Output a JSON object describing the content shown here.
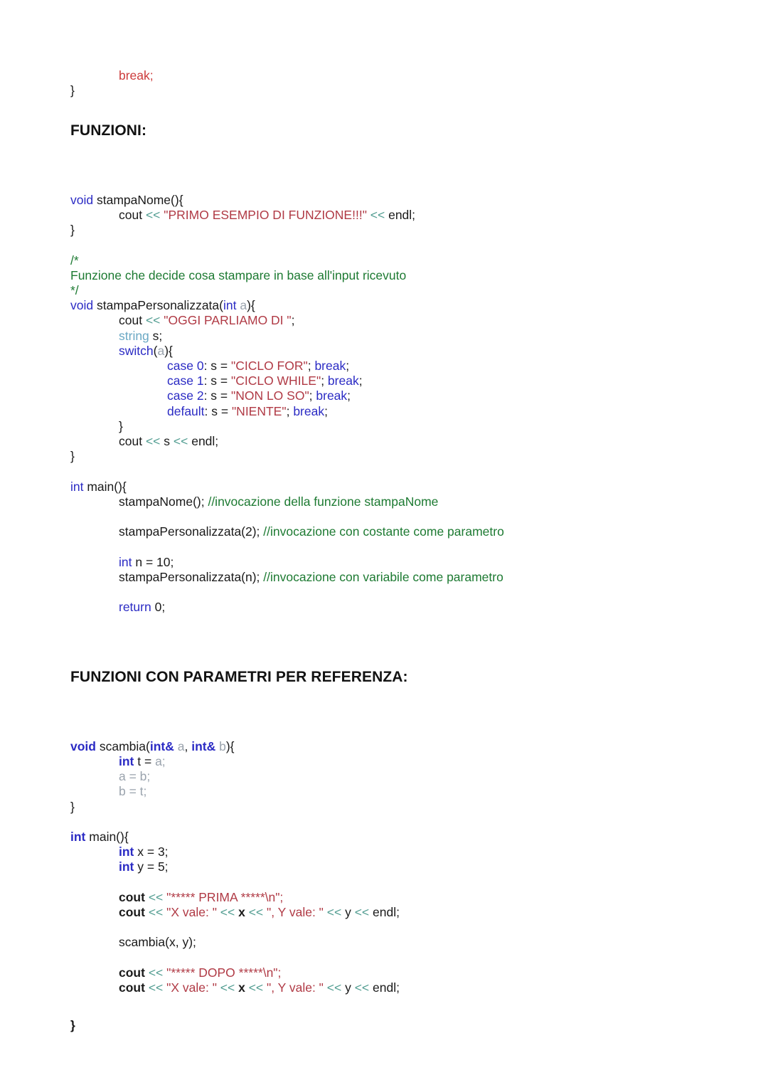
{
  "document": {
    "language": "C++",
    "locale": "it",
    "colors": {
      "keyword": "#2b2bc4",
      "type_secondary": "#6aa8c4",
      "string": "#b03a45",
      "comment": "#1d7a32",
      "operator": "#4e9b8f",
      "parameter": "#9aa3ad",
      "break_red": "#cc3b3b",
      "text": "#1a1a1a",
      "background": "#ffffff"
    }
  },
  "headings": {
    "funzioni": "FUNZIONI:",
    "funzioni_referenza": "FUNZIONI CON PARAMETRI PER REFERENZA:"
  },
  "snippet_top": {
    "break": "break;",
    "close_brace": "}"
  },
  "stampa_nome": {
    "signature_kw": "void",
    "signature_rest": " stampaNome(){",
    "cout": "cout ",
    "op1": "<<",
    "string": " \"PRIMO ESEMPIO DI FUNZIONE!!!\" ",
    "op2": "<<",
    "endl": " endl;",
    "close_brace": "}"
  },
  "comment_block": {
    "open": "/*",
    "text": "Funzione che decide cosa stampare in base all'input ricevuto",
    "close": "*/"
  },
  "stampa_personalizzata": {
    "kw_void": "void",
    "name_open": " stampaPersonalizzata(",
    "kw_int": "int",
    "param_a": " a",
    "close_paren": "){",
    "cout": "cout ",
    "op1": "<<",
    "str_oggi": " \"OGGI PARLIAMO DI \"",
    "semicolon": ";",
    "kw_string": "string",
    "var_s": " s;",
    "kw_switch": "switch",
    "switch_open": "(",
    "switch_param": "a",
    "switch_close": "){",
    "cases": [
      {
        "label": "case 0",
        "assign": ": s = ",
        "value": "\"CICLO FOR\"",
        "sep": "; ",
        "break": "break",
        "end": ";"
      },
      {
        "label": "case 1",
        "assign": ": s = ",
        "value": "\"CICLO WHILE\"",
        "sep": "; ",
        "break": "break",
        "end": ";"
      },
      {
        "label": "case 2",
        "assign": ": s = ",
        "value": "\"NON LO SO\"",
        "sep": "; ",
        "break": "break",
        "end": ";"
      },
      {
        "label": "default",
        "assign": ": s = ",
        "value": "\"NIENTE\"",
        "sep": "; ",
        "break": "break",
        "end": ";"
      }
    ],
    "switch_close_brace": "}",
    "cout2": "cout ",
    "op2": "<<",
    "var_s2": " s ",
    "op3": "<<",
    "endl": " endl;",
    "close_brace": "}"
  },
  "main_one": {
    "kw_int": "int",
    "signature_rest": " main(){",
    "call_stampa_nome": "stampaNome(); ",
    "comment_stampa_nome": "//invocazione della funzione stampaNome",
    "call_personalizzata_const": "stampaPersonalizzata(2); ",
    "comment_const": "//invocazione con costante come parametro",
    "decl_int": "int",
    "decl_rest": " n = 10;",
    "call_personalizzata_var": "stampaPersonalizzata(n); ",
    "comment_var": "//invocazione con variabile come parametro",
    "kw_return": "return",
    "return_rest": " 0;"
  },
  "scambia": {
    "kw_void": "void",
    "name_open": " scambia(",
    "kw_int_ref_1": "int&",
    "param_a": " a",
    "comma": ", ",
    "kw_int_ref_2": "int&",
    "param_b": " b",
    "close_paren": "){",
    "decl_int": "int",
    "decl_t": " t = ",
    "decl_t_val": "a;",
    "assign_a": "a = b;",
    "assign_b": "b = t;",
    "close_brace": "}"
  },
  "main_two": {
    "kw_int": "int",
    "signature_rest": " main(){",
    "decl_x_kw": "int",
    "decl_x_rest": " x = 3;",
    "decl_y_kw": "int",
    "decl_y_rest": " y = 5;",
    "cout_prima": "cout ",
    "op_prima": "<<",
    "str_prima": " \"***** PRIMA *****\\n\";",
    "cout_vals_1": "cout ",
    "op_v1": "<<",
    "str_x_1": " \"X vale: \" ",
    "op_v2": "<<",
    "var_x_1": " x ",
    "op_v3": "<<",
    "str_y_1": " \", Y vale: \" ",
    "op_v4": "<<",
    "var_y_1": " y ",
    "op_v5": "<<",
    "endl_1": " endl;",
    "call_scambia": "scambia(x, y);",
    "cout_dopo": "cout ",
    "op_dopo": "<<",
    "str_dopo": " \"***** DOPO *****\\n\";",
    "cout_vals_2": "cout ",
    "op_w1": "<<",
    "str_x_2": " \"X vale: \" ",
    "op_w2": "<<",
    "var_x_2": " x ",
    "op_w3": "<<",
    "str_y_2": " \", Y vale: \" ",
    "op_w4": "<<",
    "var_y_2": " y ",
    "op_w5": "<<",
    "endl_2": " endl;",
    "close_brace": "}"
  }
}
